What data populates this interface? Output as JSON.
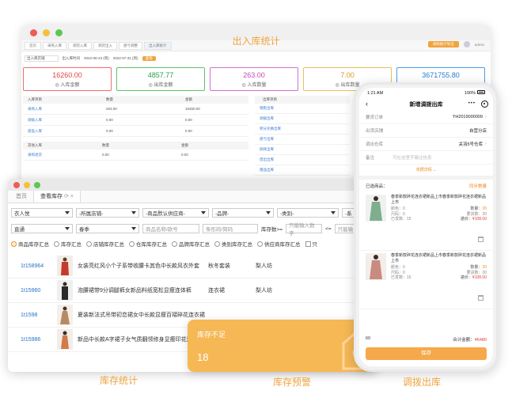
{
  "stats_window": {
    "title": "出入库统计",
    "tabs": [
      "首页",
      "采购入库",
      "调货入库",
      "调货出入",
      "盘亏调整",
      "出入库统计"
    ],
    "top_button": "采购统计导出",
    "user": "admin",
    "filter": {
      "type": "出入库店铺",
      "time_label": "出入库时间",
      "date_from": "2022-06-23 (周)",
      "date_to": "2022-07-31 (周)",
      "query_button": "查询"
    },
    "cards": [
      {
        "value": "16260.00",
        "label": "入库金额"
      },
      {
        "value": "4857.77",
        "label": "出库金额"
      },
      {
        "value": "263.00",
        "label": "入库数量"
      },
      {
        "value": "7.00",
        "label": "出库数量"
      },
      {
        "value": "3671755.80",
        "label": ""
      }
    ],
    "in_table": {
      "headers": [
        "入库项目",
        "数量",
        "金额"
      ],
      "rows": [
        [
          "采购入库",
          "263.00",
          "16260.00"
        ],
        [
          "调拨入库",
          "0.00",
          "0.00"
        ],
        [
          "盘盈入库",
          "0.00",
          "0.00"
        ]
      ]
    },
    "other_table": {
      "headers": [
        "其他入库",
        "数量",
        "金额"
      ],
      "rows": [
        [
          "采购退货",
          "0.00",
          "0.00"
        ]
      ]
    },
    "out_list": {
      "header": "出库项目",
      "items": [
        "销售出库",
        "调拨出库",
        "积分兑换出库",
        "盘亏出库",
        "损耗出库",
        "借出出库",
        "赠品出库"
      ]
    }
  },
  "inventory_window": {
    "tabs": [
      "首页",
      "查看库存"
    ],
    "filters_row1": [
      "衣人悦",
      "-所属店铺-",
      "-商品默认供应商-",
      "-品牌-",
      "-类别-",
      "-系"
    ],
    "filters_row2": {
      "select1": "直通",
      "select2": "春季",
      "name_placeholder": "商品名称/款号",
      "barcode_placeholder": "条形码/简码",
      "stock_label": "库存数>=",
      "stock_placeholder": "只能输入数字",
      "le_label": "<=",
      "le_placeholder": "只能输"
    },
    "radios": [
      "商品库存汇总",
      "库存汇总",
      "店铺库存汇总",
      "仓库库存汇总",
      "品牌库存汇总",
      "类别库存汇总",
      "供应商库存汇总"
    ],
    "checkbox": "只",
    "rows": [
      {
        "id": "1t158964",
        "name": "女装亮红风小个子系带收腰卡其色中长款风衣外套",
        "season": "秋冬套装",
        "brand": "梨人坊"
      },
      {
        "id": "1t15960",
        "name": "泡腰裙带9分调腿裤女新品料纸宽松显瘦连体裤",
        "season": "连衣裙",
        "brand": "梨人坊"
      },
      {
        "id": "1t1598",
        "name": "夏装新法式吊带初恋裙女中长款显瘦百褶碎花连衣裙",
        "season": "",
        "brand": ""
      },
      {
        "id": "1t15986",
        "name": "新品中长款A字裙子女气质翻领修身显瘦印花连衣裙",
        "season": "",
        "brand": ""
      }
    ]
  },
  "alert_card": {
    "title": "库存不足",
    "value": "18"
  },
  "phone": {
    "time": "1:21 AM",
    "battery": "100%",
    "title": "新增调拨出库",
    "form": [
      {
        "key": "要货订单",
        "value": "YH2019000009"
      },
      {
        "key": "出货店铺",
        "value": "自营分店"
      },
      {
        "key": "调出仓库",
        "value": "关羽5号仓库"
      }
    ],
    "remark_key": "备注",
    "remark_placeholder": "可在这里手输注信息",
    "detail_button": "单据详情",
    "selected_label": "已选商品：",
    "sync_label": "同步数量",
    "products": [
      {
        "name": "春季新款碎花连衣裙新品上市春季新款碎花连衣裙新品上市",
        "color": "颜色：0",
        "size": "尺码：0",
        "qty_label": "数量：",
        "qty": "20",
        "req": "要货数：20",
        "price_label": "进价：",
        "price": "¥108.00",
        "ship": "已发数：15"
      },
      {
        "name": "春季新款碎花连衣裙新品上市春季新款碎花连衣裙新品上市",
        "color": "颜色：0",
        "size": "尺码：0",
        "qty_label": "数量：",
        "qty": "20",
        "req": "要货数：20",
        "price_label": "进价：",
        "price": "¥108.00",
        "ship": "已发数：15"
      }
    ],
    "total_count": "60",
    "total_label": "合计金额：",
    "total_amount": "¥6480",
    "save_button": "保存"
  },
  "captions": {
    "inventory": "库存统计",
    "alert": "库存预警",
    "transfer": "调拨出库"
  },
  "colors": {
    "accent": "#f0a43c",
    "alert": "#f5b855"
  }
}
